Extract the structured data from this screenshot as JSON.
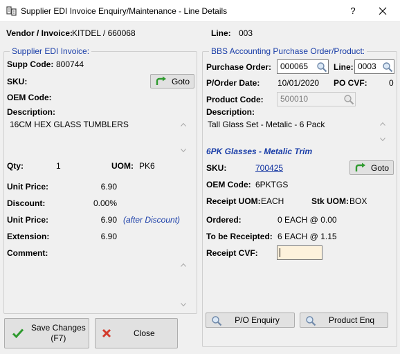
{
  "window": {
    "title": "Supplier EDI Invoice Enquiry/Maintenance - Line Details",
    "help_label": "?"
  },
  "header": {
    "vendor_label": "Vendor / Invoice:",
    "vendor_value": "KITDEL / 660068",
    "line_label": "Line:",
    "line_value": "003"
  },
  "left": {
    "legend": "Supplier EDI Invoice:",
    "supp_code_label": "Supp Code:",
    "supp_code_value": "800744",
    "sku_label": "SKU:",
    "goto_label": "Goto",
    "oem_code_label": "OEM Code:",
    "description_label": "Description:",
    "description_value": "16CM HEX GLASS TUMBLERS",
    "qty_label": "Qty:",
    "qty_value": "1",
    "uom_label": "UOM:",
    "uom_value": "PK6",
    "unit_price_label": "Unit Price:",
    "unit_price_value": "6.90",
    "discount_label": "Discount:",
    "discount_value": "0.00%",
    "unit_price2_label": "Unit Price:",
    "unit_price2_value": "6.90",
    "after_discount_note": "(after Discount)",
    "extension_label": "Extension:",
    "extension_value": "6.90",
    "comment_label": "Comment:"
  },
  "right": {
    "legend": "BBS Accounting Purchase Order/Product:",
    "purchase_order_label": "Purchase Order:",
    "purchase_order_value": "000065",
    "line_label": "Line:",
    "line_value": "0003",
    "porder_date_label": "P/Order Date:",
    "porder_date_value": "10/01/2020",
    "po_cvf_label": "PO CVF:",
    "po_cvf_value": "0",
    "product_code_label": "Product Code:",
    "product_code_value": "500010",
    "description_label": "Description:",
    "description_value": "Tall Glass Set - Metalic - 6 Pack",
    "product_title": "6PK Glasses - Metalic Trim",
    "sku_label": "SKU:",
    "sku_value": "700425",
    "goto_label": "Goto",
    "oem_code_label": "OEM Code:",
    "oem_code_value": "6PKTGS",
    "receipt_uom_label": "Receipt UOM:",
    "receipt_uom_value": "EACH",
    "stk_uom_label": "Stk UOM:",
    "stk_uom_value": "BOX",
    "ordered_label": "Ordered:",
    "ordered_value": "0 EACH @ 0.00",
    "to_be_receipted_label": "To be Receipted:",
    "to_be_receipted_value": "6 EACH @ 1.15",
    "receipt_cvf_label": "Receipt CVF:",
    "receipt_cvf_value": "",
    "po_enquiry_label": "P/O Enquiry",
    "product_enq_label": "Product Enq"
  },
  "footer": {
    "save_label_line1": "Save Changes",
    "save_label_line2": "(F7)",
    "close_label": "Close"
  },
  "colors": {
    "accent_blue": "#1a3ea8",
    "link_blue": "#0a2d9e",
    "goto_green": "#2e9a2e",
    "close_red": "#d33b2c"
  }
}
